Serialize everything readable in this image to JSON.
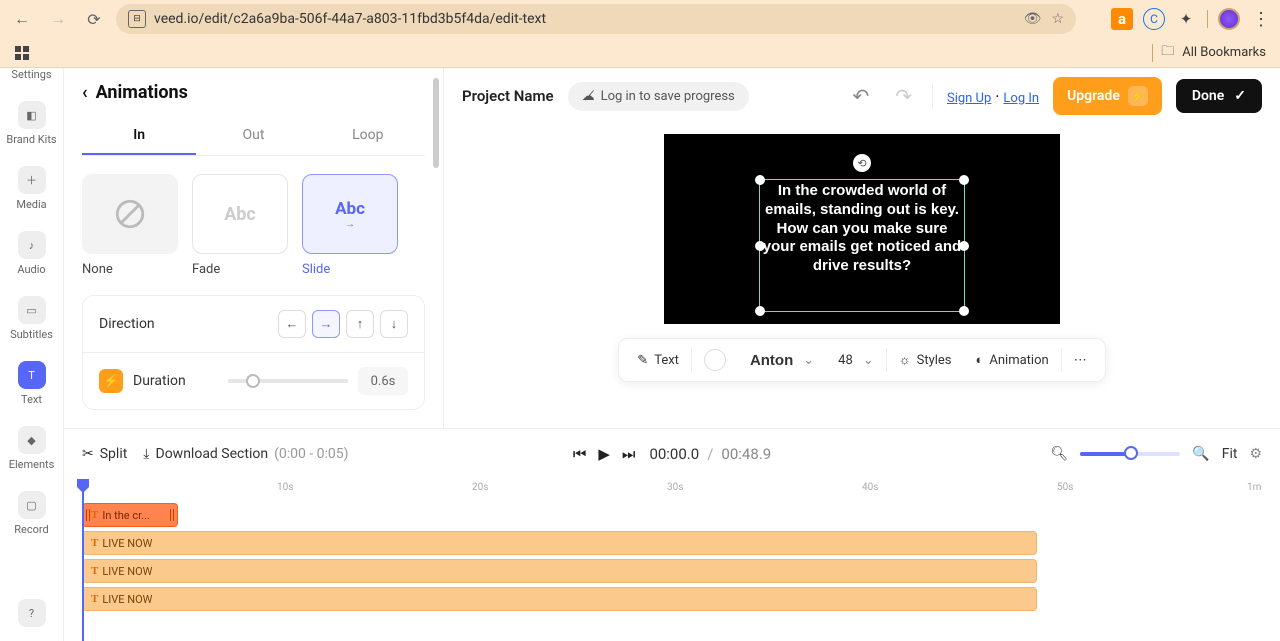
{
  "browser": {
    "url": "veed.io/edit/c2a6a9ba-506f-44a7-a803-11fbd3b5f4da/edit-text",
    "all_bookmarks": "All Bookmarks"
  },
  "rail": {
    "settings": "Settings",
    "brand_kits": "Brand Kits",
    "media": "Media",
    "audio": "Audio",
    "subtitles": "Subtitles",
    "text": "Text",
    "elements": "Elements",
    "record": "Record"
  },
  "anim": {
    "title": "Animations",
    "tabs": {
      "in": "In",
      "out": "Out",
      "loop": "Loop"
    },
    "cards": {
      "none": "None",
      "fade": "Fade",
      "slide": "Slide",
      "abc": "Abc"
    },
    "direction_label": "Direction",
    "duration_label": "Duration",
    "duration_value": "0.6s"
  },
  "topbar": {
    "project": "Project Name",
    "login_hint": "Log in to save progress",
    "signup": "Sign Up",
    "login": "Log In",
    "upgrade": "Upgrade",
    "done": "Done"
  },
  "canvas": {
    "text": "In the crowded world of emails, standing out is key. How can you make sure your emails get noticed and drive results?"
  },
  "text_toolbar": {
    "text": "Text",
    "font": "Anton",
    "size": "48",
    "styles": "Styles",
    "animation": "Animation"
  },
  "timeline": {
    "split": "Split",
    "download": "Download Section",
    "range": "(0:00 - 0:05)",
    "current": "00:00.0",
    "total": "00:48.9",
    "fit": "Fit",
    "marks": {
      "s10": "10s",
      "s20": "20s",
      "s30": "30s",
      "s40": "40s",
      "s50": "50s",
      "m1": "1m"
    },
    "clip1": "In the cr...",
    "live": "LIVE NOW"
  }
}
